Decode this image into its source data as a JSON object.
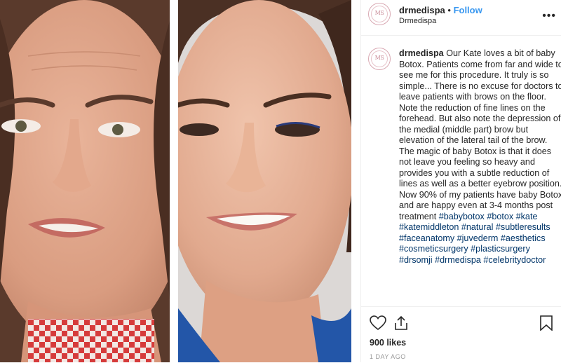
{
  "post": {
    "username": "drmedispa",
    "dot": "•",
    "follow_label": "Follow",
    "subtitle": "Drmedispa",
    "avatar_monogram": "MS",
    "caption_text": "Our Kate loves a bit of baby Botox. Patients come from far and wide to see me for this procedure. It truly is so simple... There is no excuse for doctors to leave patients with brows on the floor. Note the reduction of fine lines on the forehead. But also note the depression of the medial (middle part) brow but elevation of the lateral tail of the brow. The magic of baby Botox is that it does not leave you feeling so heavy and provides you with a subtle reduction of lines as well as a better eyebrow position. Now 90% of my patients have baby Botox and are happy even at 3-4 months post treatment",
    "hashtags": "#babybotox #botox #kate #katemiddleton #natural #subtleresults #faceanatomy #juvederm #aesthetics #cosmeticsurgery #plasticsurgery #drsomji #drmedispa #celebritydoctor",
    "likes": "900 likes",
    "time_ago": "1 DAY AGO"
  },
  "icons": {
    "more": "more-options-icon",
    "heart": "heart-icon",
    "share": "share-icon",
    "bookmark": "bookmark-icon"
  },
  "colors": {
    "follow": "#3897f0",
    "hashtag": "#003569",
    "text": "#262626",
    "muted": "#999999"
  }
}
